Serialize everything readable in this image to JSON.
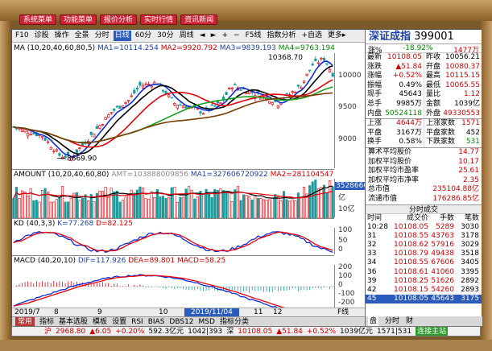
{
  "top_menu": [
    "系统菜单",
    "功能菜单",
    "报价分析",
    "实时行情",
    "资讯新闻"
  ],
  "toolbar": {
    "items": [
      "F10",
      "诊股",
      "操作",
      "全景",
      "分时",
      "日线",
      "60分",
      "30分",
      "周线",
      "◄",
      "►",
      "+",
      "−",
      "F5线",
      "指数分析",
      "+自选",
      "更多▸"
    ],
    "active": "日线"
  },
  "ma_legend": {
    "label": "MA",
    "params": "(10,20,40,60,80,5)",
    "ma1": "MA1=10114.254",
    "ma2": "MA2=9920.792",
    "ma3": "MA3=9839.193",
    "ma4": "MA4=9763.194"
  },
  "price_axis": [
    "10000",
    "9500",
    "9000"
  ],
  "price_annotations": {
    "high": "10368.70",
    "low": "8669.90"
  },
  "volume_legend": {
    "label": "AMOUNT",
    "params": "(10,20,40,60,80)",
    "amt": "AMT=103888009856",
    "ma1": "MA1=327606720922",
    "ma2": "MA2=281104547"
  },
  "volume_axis": {
    "tag": "3528660",
    "unit": "亿",
    "label": "10亿"
  },
  "kd_legend": {
    "label": "KD",
    "params": "(40,3,3)",
    "k": "K=77.268",
    "d": "D=82.125"
  },
  "kd_axis": [
    "100",
    "50",
    "0"
  ],
  "macd_legend": {
    "label": "MACD",
    "params": "(40,20,10)",
    "dif": "DIF=117.926",
    "dea": "DEA=89.801",
    "macd": "MACD=58.25"
  },
  "macd_axis": [
    "200",
    "100",
    "0",
    "-100",
    "-200"
  ],
  "date_strip": {
    "start": "2019/7",
    "m8": "8",
    "m9": "9",
    "m10": "10",
    "cursor_date": "2019/11/04",
    "m11": "11",
    "m12": "12",
    "end": "F线"
  },
  "bottom_tabs": [
    "常用",
    "指标",
    "基本选股",
    "模板",
    "设置",
    "RSI",
    "BIAS",
    "DBS12",
    "MSD",
    "指标分类"
  ],
  "quote": {
    "name": "深证成指",
    "code": "399001",
    "pct_label": "涨%",
    "pct": "-18.92%",
    "rank": "1477万",
    "rows": [
      [
        [
          "最新",
          "10108.05",
          "red"
        ],
        [
          "昨收",
          "10056.21",
          ""
        ]
      ],
      [
        [
          "涨跌",
          "▲51.84",
          "red"
        ],
        [
          "开盘",
          "10080.37",
          "red"
        ]
      ],
      [
        [
          "涨幅",
          "+0.52%",
          "red"
        ],
        [
          "最高",
          "10115.15",
          "red"
        ]
      ],
      [
        [
          "振幅",
          "0.49%",
          ""
        ],
        [
          "最低",
          "10065.55",
          "red"
        ]
      ],
      [
        [
          "现手",
          "45643",
          ""
        ],
        [
          "量比",
          "1.12",
          "red"
        ]
      ],
      [
        [
          "总手",
          "9985万",
          ""
        ],
        [
          "金额",
          "1039亿",
          ""
        ]
      ],
      [
        [
          "内盘",
          "50524118",
          "green"
        ],
        [
          "外盘",
          "49330553",
          "red"
        ]
      ]
    ],
    "stats": [
      [
        [
          "上涨",
          "4644万",
          "red"
        ],
        [
          "上涨家数",
          "1571",
          "red"
        ]
      ],
      [
        [
          "平盘",
          "3167万",
          ""
        ],
        [
          "平盘家数",
          "452",
          ""
        ]
      ],
      [
        [
          "换手",
          "0.58%",
          ""
        ],
        [
          "下跌家数",
          "531",
          "green"
        ]
      ]
    ],
    "extra": [
      [
        "算术平均股价",
        "14.77"
      ],
      [
        "加权平均股价",
        "10.17"
      ],
      [
        "加权平均市盈率",
        "25.61"
      ],
      [
        "加权平均市净率",
        "2.35"
      ],
      [
        "总市值",
        "235104.88亿"
      ],
      [
        "流通市值",
        "176286.85亿"
      ]
    ],
    "trade_title": "分时成交",
    "trade_header": [
      "时间",
      "成交价",
      "手数",
      "笔数"
    ],
    "trades": [
      [
        "10:28",
        "10108.05",
        "5289",
        "3030"
      ],
      [
        "31",
        "10108.55",
        "43763",
        "3178"
      ],
      [
        "32",
        "10108.62",
        "57916",
        "3029"
      ],
      [
        "33",
        "10108.79",
        "49438",
        "3518"
      ],
      [
        "34",
        "10108.55",
        "67606",
        "3405"
      ],
      [
        "36",
        "10108.61",
        "41060",
        "3395"
      ],
      [
        "39",
        "10108.25",
        "51626",
        "2892"
      ],
      [
        "42",
        "10108.15",
        "54260",
        "2893"
      ],
      [
        "45",
        "10108.05",
        "45643",
        "3175"
      ]
    ],
    "tabs": [
      "盘",
      "分时",
      "财"
    ]
  },
  "status_bar": {
    "sh_label": "沪",
    "sh_price": "2968.80",
    "sh_change": "▲6.05",
    "sh_pct": "+0.20%",
    "sh_amt": "592.3亿元",
    "sh_ratio": "1042|393",
    "sz_label": "深",
    "sz_price": "10108.05",
    "sz_change": "▲51.84",
    "sz_pct": "+0.52%",
    "sz_amt": "1039亿元",
    "sz_ratio": "1571|531",
    "conn": "连接主站"
  },
  "colors": {
    "ma1": "#000000",
    "ma2": "#e8000b",
    "ma3": "#0a2bd8",
    "ma4": "#19a01e",
    "up": "#e8000b",
    "down": "#1a9a9a"
  }
}
